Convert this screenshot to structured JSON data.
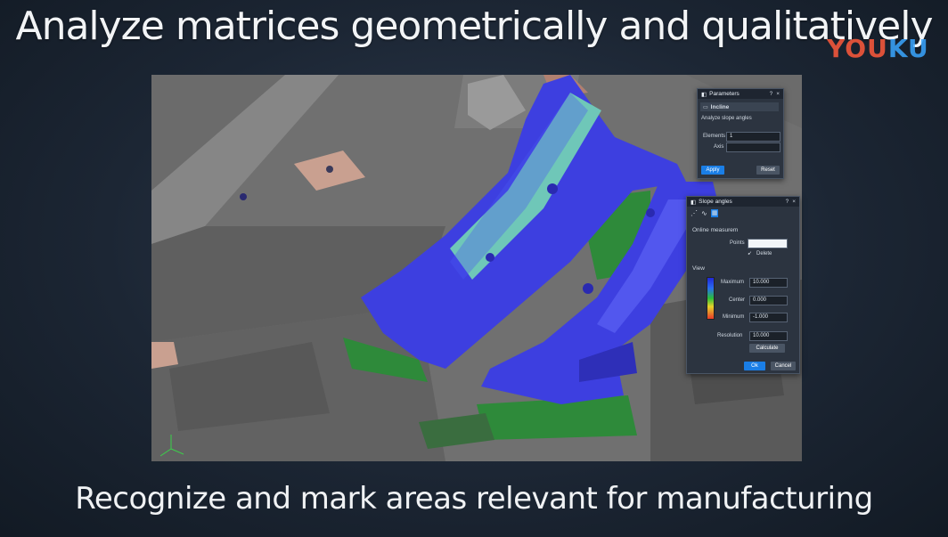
{
  "headline": "Analyze matrices geometrically and qualitatively",
  "watermark": {
    "part1": "YOU",
    "part2": "KU"
  },
  "caption": "Recognize and mark areas relevant for manufacturing",
  "parameters_panel": {
    "title": "Parameters",
    "section_title": "Incline",
    "description": "Analyze slope angles",
    "elements_label": "Elements",
    "elements_value": "1",
    "axis_label": "Axis",
    "apply_label": "Apply",
    "reset_label": "Reset",
    "help_icon": "?",
    "close_icon": "×"
  },
  "slope_panel": {
    "title": "Slope angles",
    "online_measurement_label": "Online measurem",
    "points_label": "Points",
    "delete_label": "Delete",
    "view_label": "View",
    "maximum_label": "Maximum",
    "maximum_value": "10.000",
    "center_label": "Center",
    "center_value": "0.000",
    "minimum_label": "Minimum",
    "minimum_value": "-1.000",
    "resolution_label": "Resolution",
    "resolution_value": "10.000",
    "calculate_label": "Calculate",
    "ok_label": "Ok",
    "cancel_label": "Cancel",
    "help_icon": "?",
    "close_icon": "×"
  },
  "colors": {
    "part_blue": "#3d3fe0",
    "part_green": "#2e8a3a",
    "part_teal": "#6fc7b8",
    "die_gray": "#6b6b6b",
    "accent_button": "#1a7ee6"
  }
}
